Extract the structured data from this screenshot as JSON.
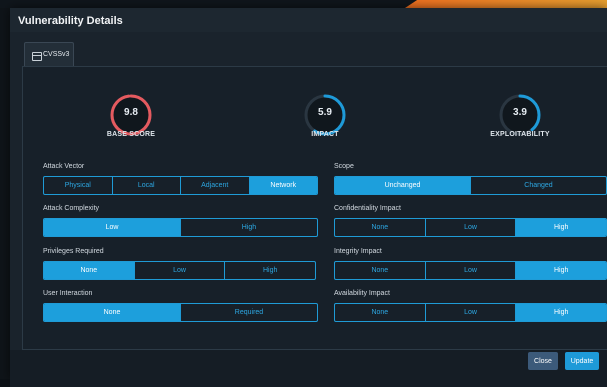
{
  "modal": {
    "title": "Vulnerability Details"
  },
  "tabs": [
    {
      "label": "CVSSv3",
      "icon": "calculator-icon"
    }
  ],
  "scores": [
    {
      "value": "9.8",
      "label": "BASE SCORE",
      "fraction": 0.98,
      "color": "#e55a5f"
    },
    {
      "value": "5.9",
      "label": "IMPACT",
      "fraction": 0.59,
      "color": "#1e9ad8"
    },
    {
      "value": "3.9",
      "label": "EXPLOITABILITY",
      "fraction": 0.39,
      "color": "#1e9ad8"
    }
  ],
  "metrics": {
    "attack_vector": {
      "label": "Attack Vector",
      "options": [
        "Physical",
        "Local",
        "Adjacent",
        "Network"
      ],
      "selected": "Network"
    },
    "attack_complexity": {
      "label": "Attack Complexity",
      "options": [
        "Low",
        "High"
      ],
      "selected": "Low"
    },
    "privileges_required": {
      "label": "Privileges Required",
      "options": [
        "None",
        "Low",
        "High"
      ],
      "selected": "None"
    },
    "user_interaction": {
      "label": "User Interaction",
      "options": [
        "None",
        "Required"
      ],
      "selected": "None"
    },
    "scope": {
      "label": "Scope",
      "options": [
        "Unchanged",
        "Changed"
      ],
      "selected": "Unchanged"
    },
    "confidentiality_impact": {
      "label": "Confidentiality Impact",
      "options": [
        "None",
        "Low",
        "High"
      ],
      "selected": "High"
    },
    "integrity_impact": {
      "label": "Integrity Impact",
      "options": [
        "None",
        "Low",
        "High"
      ],
      "selected": "High"
    },
    "availability_impact": {
      "label": "Availability Impact",
      "options": [
        "None",
        "Low",
        "High"
      ],
      "selected": "High"
    }
  },
  "footer": {
    "close_label": "Close",
    "update_label": "Update"
  },
  "colors": {
    "accent": "#1e9ad8",
    "critical": "#e55a5f"
  }
}
